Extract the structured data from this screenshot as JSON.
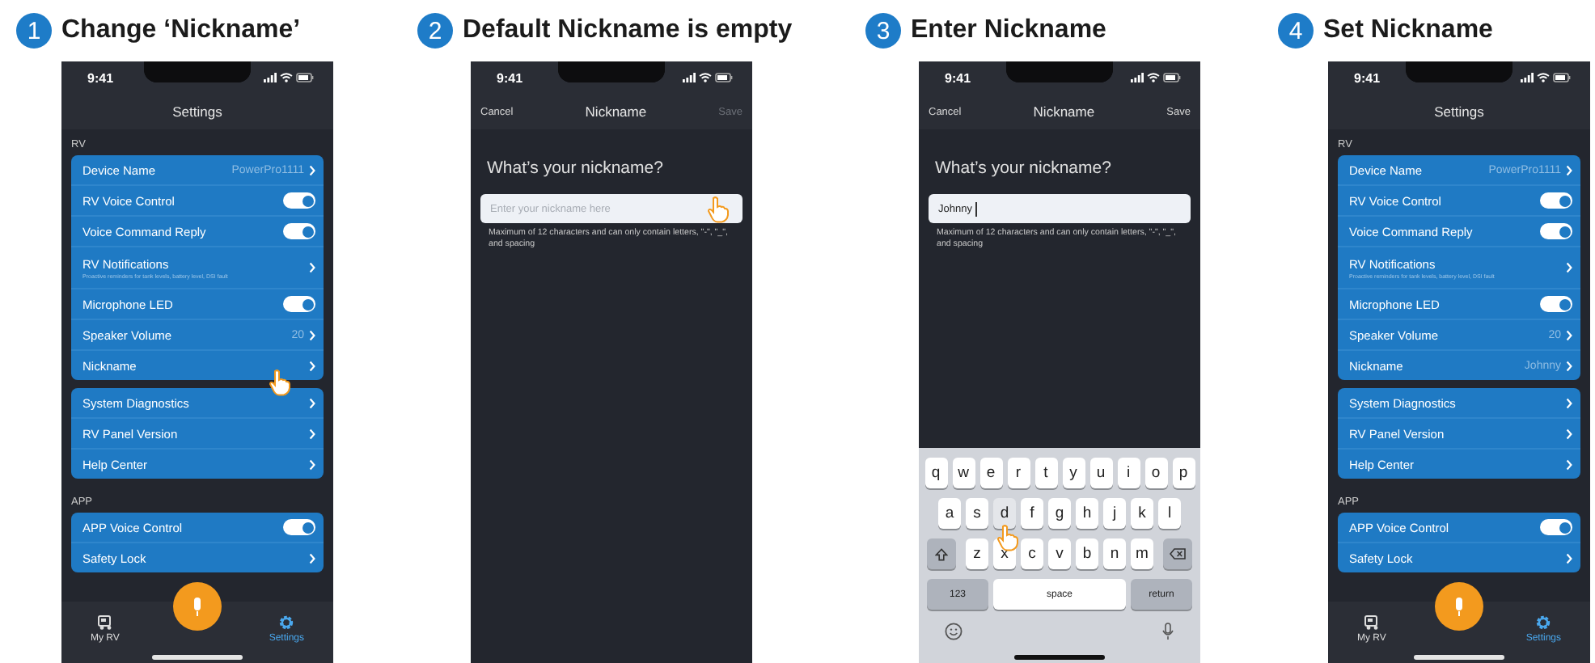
{
  "steps": [
    {
      "number": "1",
      "title": "Change ‘Nickname’",
      "screen": {
        "kind": "settings",
        "time": "9:41",
        "title": "Settings",
        "sections": [
          {
            "heading": "RV",
            "rows": [
              {
                "kind": "link",
                "label": "Device Name",
                "value": "PowerPro1111",
                "touched": false
              },
              {
                "kind": "toggle",
                "label": "RV Voice Control",
                "on": true,
                "touched": false
              },
              {
                "kind": "toggle",
                "label": "Voice Command Reply",
                "on": true,
                "touched": false
              },
              {
                "kind": "link",
                "label": "RV Notifications",
                "sublabel": "Proactive reminders for tank levels, battery level, DSI fault",
                "touched": false
              },
              {
                "kind": "toggle",
                "label": "Microphone LED",
                "on": true,
                "touched": false
              },
              {
                "kind": "link",
                "label": "Speaker Volume",
                "value": "20",
                "touched": false
              },
              {
                "kind": "link",
                "label": "Nickname",
                "touched": true
              }
            ]
          },
          {
            "rows": [
              {
                "kind": "link",
                "label": "System Diagnostics",
                "touched": false
              },
              {
                "kind": "link",
                "label": "RV Panel Version",
                "touched": false
              },
              {
                "kind": "link",
                "label": "Help Center",
                "touched": false
              }
            ]
          },
          {
            "heading": "APP",
            "rows": [
              {
                "kind": "toggle",
                "label": "APP Voice Control",
                "on": true,
                "touched": false
              },
              {
                "kind": "link",
                "label": "Safety Lock",
                "touched": false
              }
            ]
          }
        ],
        "tabs": [
          {
            "kind": "rv",
            "label": "My RV",
            "selected": false
          },
          {
            "kind": "settings",
            "label": "Settings",
            "selected": true
          }
        ]
      }
    },
    {
      "number": "2",
      "title": "Default Nickname is empty",
      "screen": {
        "kind": "form",
        "time": "9:41",
        "cancel": "Cancel",
        "title": "Nickname",
        "save": "Save",
        "save_enabled": false,
        "question": "What’s your nickname?",
        "field": {
          "placeholder": "Enter your nickname here",
          "touched": true,
          "focused": false
        },
        "hint": "Maximum of 12 characters and can only contain letters, \"-\", \"_\", and spacing"
      }
    },
    {
      "number": "3",
      "title": "Enter Nickname",
      "screen": {
        "kind": "form",
        "time": "9:41",
        "cancel": "Cancel",
        "title": "Nickname",
        "save": "Save",
        "save_enabled": true,
        "question": "What’s your nickname?",
        "field": {
          "value": "Johnny",
          "touched": false,
          "focused": true
        },
        "hint": "Maximum of 12 characters and can only contain letters, \"-\", \"_\", and spacing",
        "keyboard": {
          "key_rows": [
            {
              "keys": [
                {
                  "kind": "letter",
                  "label": "q",
                  "touched": false
                },
                {
                  "kind": "letter",
                  "label": "w",
                  "touched": false
                },
                {
                  "kind": "letter",
                  "label": "e",
                  "touched": false
                },
                {
                  "kind": "letter",
                  "label": "r",
                  "touched": false
                },
                {
                  "kind": "letter",
                  "label": "t",
                  "touched": false
                },
                {
                  "kind": "letter",
                  "label": "y",
                  "touched": false
                },
                {
                  "kind": "letter",
                  "label": "u",
                  "touched": false
                },
                {
                  "kind": "letter",
                  "label": "i",
                  "touched": false
                },
                {
                  "kind": "letter",
                  "label": "o",
                  "touched": false
                },
                {
                  "kind": "letter",
                  "label": "p",
                  "touched": false
                }
              ]
            },
            {
              "keys": [
                {
                  "kind": "letter",
                  "label": "a",
                  "touched": false
                },
                {
                  "kind": "letter",
                  "label": "s",
                  "touched": false
                },
                {
                  "kind": "letter",
                  "label": "d",
                  "touched": true
                },
                {
                  "kind": "letter",
                  "label": "f",
                  "touched": false
                },
                {
                  "kind": "letter",
                  "label": "g",
                  "touched": false
                },
                {
                  "kind": "letter",
                  "label": "h",
                  "touched": false
                },
                {
                  "kind": "letter",
                  "label": "j",
                  "touched": false
                },
                {
                  "kind": "letter",
                  "label": "k",
                  "touched": false
                },
                {
                  "kind": "letter",
                  "label": "l",
                  "touched": false
                }
              ]
            },
            {
              "keys": [
                {
                  "kind": "shift",
                  "touched": false
                },
                {
                  "kind": "letter",
                  "label": "z",
                  "touched": false
                },
                {
                  "kind": "letter",
                  "label": "x",
                  "touched": false
                },
                {
                  "kind": "letter",
                  "label": "c",
                  "touched": false
                },
                {
                  "kind": "letter",
                  "label": "v",
                  "touched": false
                },
                {
                  "kind": "letter",
                  "label": "b",
                  "touched": false
                },
                {
                  "kind": "letter",
                  "label": "n",
                  "touched": false
                },
                {
                  "kind": "letter",
                  "label": "m",
                  "touched": false
                },
                {
                  "kind": "backspace",
                  "touched": false
                }
              ]
            },
            {
              "keys": [
                {
                  "kind": "mode",
                  "label": "123",
                  "touched": false
                },
                {
                  "kind": "space",
                  "label": "space",
                  "touched": false
                },
                {
                  "kind": "return",
                  "label": "return",
                  "touched": false
                }
              ]
            }
          ]
        }
      }
    },
    {
      "number": "4",
      "title": "Set Nickname",
      "screen": {
        "kind": "settings",
        "time": "9:41",
        "title": "Settings",
        "sections": [
          {
            "heading": "RV",
            "rows": [
              {
                "kind": "link",
                "label": "Device Name",
                "value": "PowerPro1111",
                "touched": false
              },
              {
                "kind": "toggle",
                "label": "RV Voice Control",
                "on": true,
                "touched": false
              },
              {
                "kind": "toggle",
                "label": "Voice Command Reply",
                "on": true,
                "touched": false
              },
              {
                "kind": "link",
                "label": "RV Notifications",
                "sublabel": "Proactive reminders for tank levels, battery level, DSI fault",
                "touched": false
              },
              {
                "kind": "toggle",
                "label": "Microphone LED",
                "on": true,
                "touched": false
              },
              {
                "kind": "link",
                "label": "Speaker Volume",
                "value": "20",
                "touched": false
              },
              {
                "kind": "link",
                "label": "Nickname",
                "value": "Johnny",
                "touched": false
              }
            ]
          },
          {
            "rows": [
              {
                "kind": "link",
                "label": "System Diagnostics",
                "touched": false
              },
              {
                "kind": "link",
                "label": "RV Panel Version",
                "touched": false
              },
              {
                "kind": "link",
                "label": "Help Center",
                "touched": false
              }
            ]
          },
          {
            "heading": "APP",
            "rows": [
              {
                "kind": "toggle",
                "label": "APP Voice Control",
                "on": true,
                "touched": false
              },
              {
                "kind": "link",
                "label": "Safety Lock",
                "touched": false
              }
            ]
          }
        ],
        "tabs": [
          {
            "kind": "rv",
            "label": "My RV",
            "selected": false
          },
          {
            "kind": "settings",
            "label": "Settings",
            "selected": true
          }
        ]
      }
    }
  ]
}
